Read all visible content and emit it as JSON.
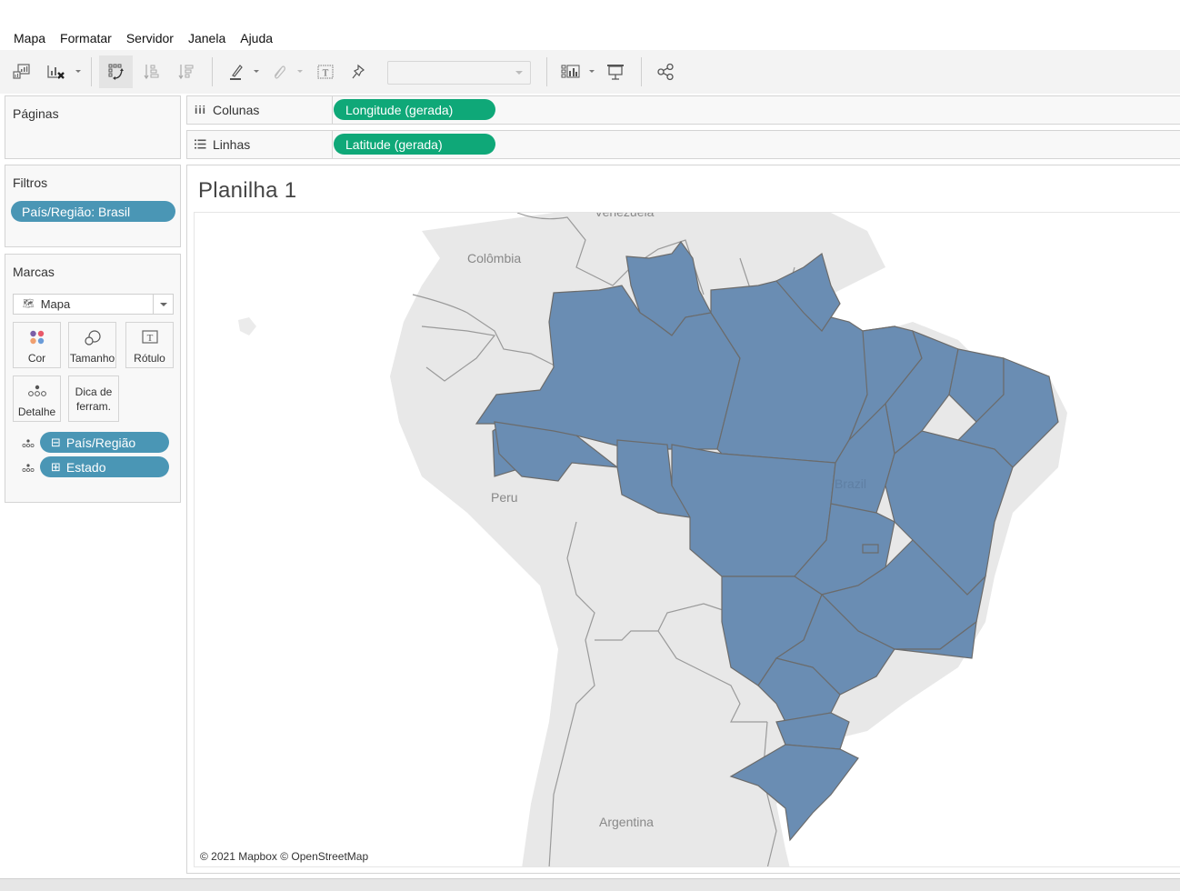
{
  "menu": {
    "items": [
      "Mapa",
      "Formatar",
      "Servidor",
      "Janela",
      "Ajuda"
    ]
  },
  "toolbar": {
    "icons": [
      "new-worksheet-icon",
      "clear-sheet-icon",
      "swap-rows-columns-icon",
      "sort-ascending-icon",
      "sort-descending-icon",
      "highlight-icon",
      "group-icon",
      "show-labels-icon",
      "pin-icon",
      "fit-dropdown",
      "show-me-icon",
      "presentation-icon",
      "share-icon"
    ],
    "fit_value": ""
  },
  "shelves": {
    "pages": {
      "title": "Páginas"
    },
    "columns": {
      "label": "Colunas",
      "pill": "Longitude (gerada)"
    },
    "rows": {
      "label": "Linhas",
      "pill": "Latitude (gerada)"
    }
  },
  "filters": {
    "title": "Filtros",
    "items": [
      "País/Região: Brasil"
    ]
  },
  "marks": {
    "title": "Marcas",
    "type": "Mapa",
    "buttons": {
      "color": "Cor",
      "size": "Tamanho",
      "label": "Rótulo",
      "detail": "Detalhe",
      "tooltip": "Dica de ferram."
    },
    "fields": [
      {
        "name": "País/Região",
        "expander": "⊟"
      },
      {
        "name": "Estado",
        "expander": "⊞"
      }
    ]
  },
  "sheet": {
    "title": "Planilha 1"
  },
  "map": {
    "labels": {
      "venezuela": "Venezuela",
      "colombia": "Colômbia",
      "peru": "Peru",
      "brazil": "Brazil",
      "argentina": "Argentina"
    },
    "attribution": "© 2021 Mapbox © OpenStreetMap",
    "colors": {
      "fill": "#6a8db3",
      "border": "#6b6b6b",
      "land": "#e8e8e8",
      "ocean": "#ffffff"
    }
  },
  "colors": {
    "dimension_pill": "#4a96b5",
    "measure_pill": "#0fa878",
    "toolbar_bg": "#f3f3f3",
    "panel_bg": "#f8f8f8"
  }
}
